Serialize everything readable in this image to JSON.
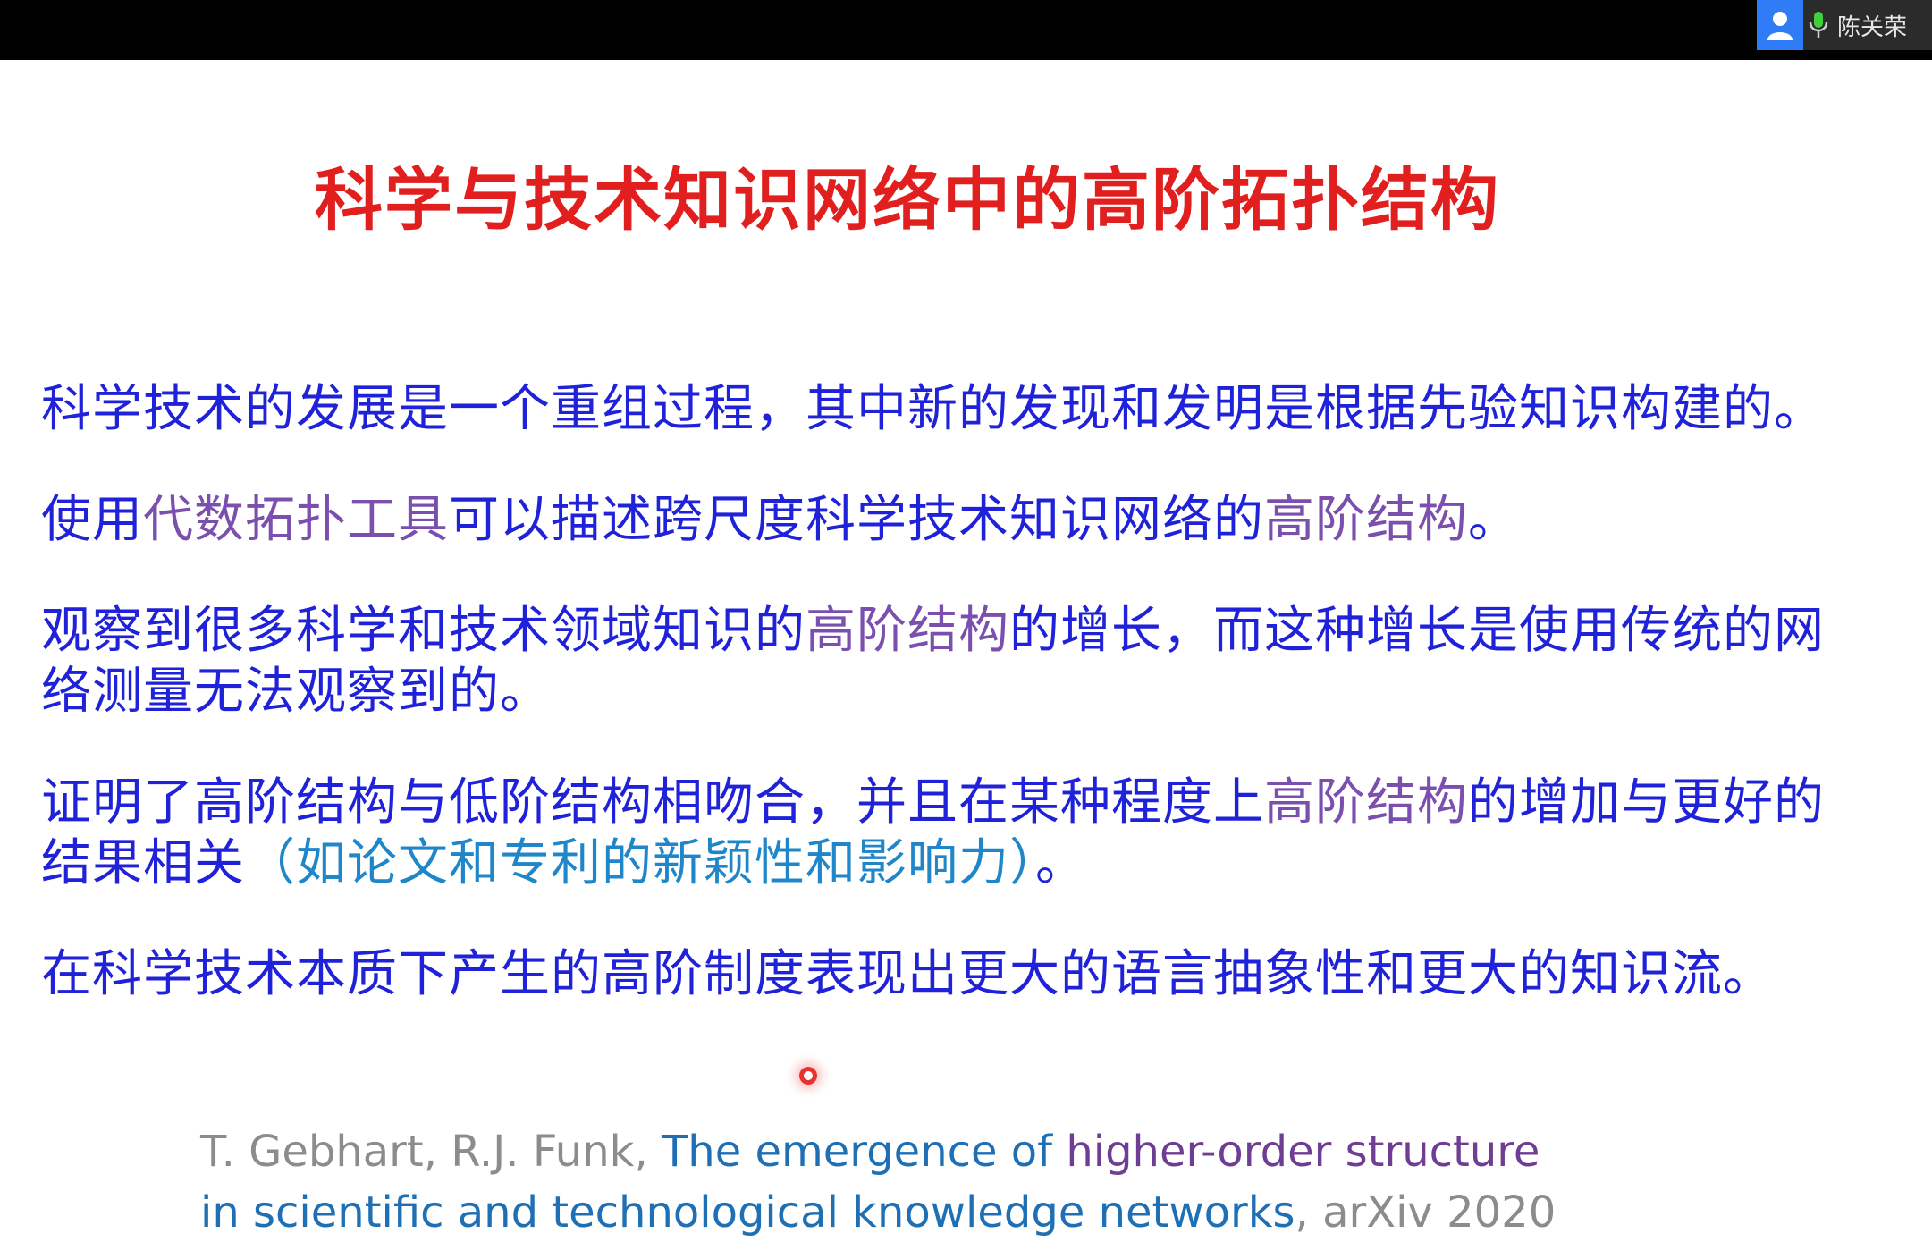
{
  "meeting": {
    "participant_name": "陈关荣"
  },
  "slide": {
    "title": "科学与技术知识网络中的高阶拓扑结构",
    "p1": "科学技术的发展是一个重组过程，其中新的发现和发明是根据先验知识构建的。",
    "p2_a": "使用",
    "p2_b": "代数拓扑工具",
    "p2_c": "可以描述跨尺度科学技术知识网络的",
    "p2_d": "高阶结构",
    "p2_e": "。",
    "p3_a": "观察到很多科学和技术领域知识的",
    "p3_b": "高阶结构",
    "p3_c": "的增长，而这种增长是使用传统的网络测量无法观察到的。",
    "p4_a": "证明了高阶结构与低阶结构相吻合，并且在某种程度上",
    "p4_b": "高阶结构",
    "p4_c": "的增加与更好的结果相关",
    "p4_d": "（如论文和专利的新颖性和影响力）",
    "p4_e": "。",
    "p5": "在科学技术本质下产生的高阶制度表现出更大的语言抽象性和更大的知识流。",
    "ref_authors": "T. Gebhart, R.J. Funk, ",
    "ref_title_a": "The emergence of ",
    "ref_title_b": "higher-order structure",
    "ref_title_c": "in scientific and technological knowledge networks",
    "ref_venue": ", arXiv 2020"
  },
  "colors": {
    "title": "#e21f1f",
    "body": "#1f22d8",
    "highlight": "#7a4fae",
    "parenthetical": "#1f86c9",
    "reference_gray": "#8c8c8c",
    "reference_blue": "#1f6fb5",
    "reference_purple": "#6f3e94",
    "avatar_bg": "#2f7cf6",
    "mic": "#3fcf3f"
  }
}
